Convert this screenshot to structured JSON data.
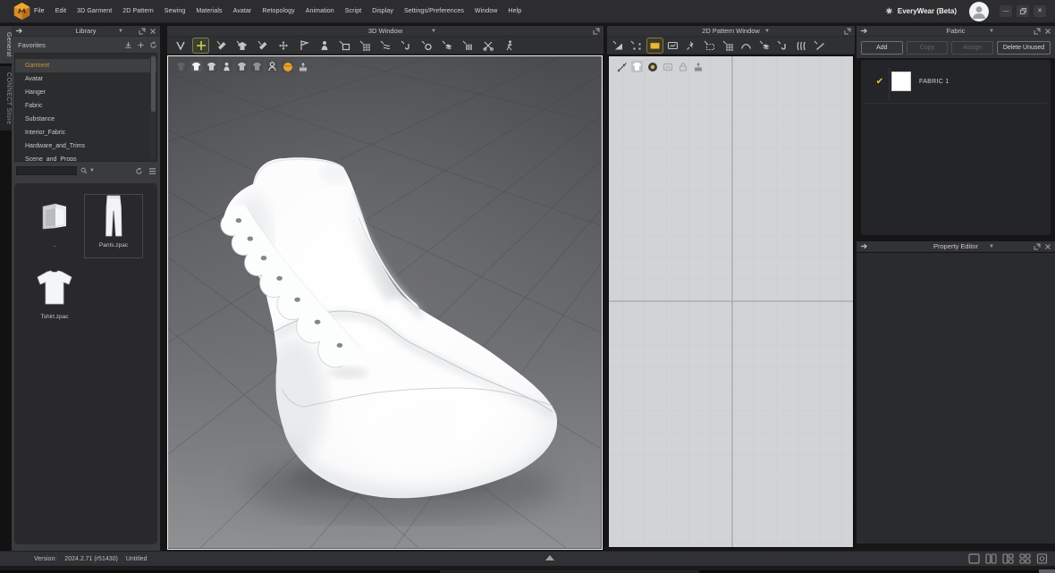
{
  "app": {
    "brand": "EveryWear (Beta)",
    "accent_color": "#cf9433",
    "selected_tool_color": "#e8b83a",
    "window_controls": [
      "minimize",
      "restore",
      "close"
    ]
  },
  "menu_bar": {
    "items": [
      "File",
      "Edit",
      "3D Garment",
      "2D Pattern",
      "Sewing",
      "Materials",
      "Avatar",
      "Retopology",
      "Animation",
      "Script",
      "Display",
      "Settings/Preferences",
      "Window",
      "Help"
    ]
  },
  "sidebar_tabs": {
    "general": "General",
    "connect_store": "CONNECT Store",
    "active": "General"
  },
  "library_panel": {
    "title": "Library",
    "favorites_label": "Favorites",
    "favorites_icons": [
      "download-icon",
      "add-icon",
      "refresh-icon"
    ],
    "favorites": [
      {
        "label": "Garment",
        "selected": true
      },
      {
        "label": "Avatar",
        "selected": false
      },
      {
        "label": "Hanger",
        "selected": false
      },
      {
        "label": "Fabric",
        "selected": false
      },
      {
        "label": "Substance",
        "selected": false
      },
      {
        "label": "Interior_Fabric",
        "selected": false
      },
      {
        "label": "Hardware_and_Trims",
        "selected": false
      },
      {
        "label": "Scene_and_Props",
        "selected": false
      }
    ],
    "search_value": "",
    "files": [
      {
        "label": "..",
        "type": "parent-folder"
      },
      {
        "label": "Pants.zpac",
        "type": "garment-pants"
      },
      {
        "label": "Tshirt.zpac",
        "type": "garment-tshirt"
      }
    ]
  },
  "viewport_3d": {
    "title": "3D Window",
    "toolbar_icons": [
      "v-stitch-tool",
      "plus-cursor-tool",
      "pen-tool",
      "garment-select-tool",
      "edit-pen-tool",
      "move-cross-tool",
      "flag-tool",
      "avatar-tool",
      "box-arrow-tool",
      "grid-arrow-tool",
      "wind-tool",
      "hook-tool",
      "ring-tool",
      "fabric-arrow-tool",
      "bars-arrow-tool",
      "scissors-tool",
      "walk-tool"
    ],
    "selected_tool_index": 1,
    "overlay_toggles": [
      "dark-shirt-toggle",
      "white-shirt-toggle",
      "texture-shirt-toggle",
      "person-toggle",
      "fabric-hand-toggle",
      "fabric-flat-toggle",
      "bust-toggle",
      "orange-sphere-toggle",
      "podium-toggle"
    ],
    "scene_object": "white high-top shoe model"
  },
  "viewport_2d": {
    "title": "2D Pattern Window",
    "toolbar_icons": [
      "transform-triangle-tool",
      "edit-points-tool",
      "yellow-rect-pattern-tool",
      "screen-rect-tool",
      "pin-tool",
      "dotted-box-tool",
      "grid-arrow-tool",
      "curve-tool",
      "fabric-arrow-tool",
      "hook-arrow-tool",
      "pleats-tool",
      "line-arrow-tool"
    ],
    "selected_tool_index": 2,
    "overlay_toggles": [
      "needle-toggle",
      "white-shirt-toggle",
      "dark-texture-toggle",
      "pale-box-toggle",
      "pale-lock-toggle",
      "podium-toggle"
    ]
  },
  "fabric_panel": {
    "title": "Fabric",
    "buttons": [
      {
        "label": "Add",
        "enabled": true
      },
      {
        "label": "Copy",
        "enabled": false
      },
      {
        "label": "Assign",
        "enabled": false
      },
      {
        "label": "Delete Unused",
        "enabled": true
      }
    ],
    "items": [
      {
        "name": "FABRIC 1",
        "checked": true,
        "swatch_color": "#ffffff"
      }
    ]
  },
  "property_editor": {
    "title": "Property Editor"
  },
  "status_bar": {
    "version_label": "Version:",
    "version_value": "2024.2.71 (r51430)",
    "document_name": "Untitled",
    "layout_icons": [
      "single-view-icon",
      "two-pane-icon",
      "one-plus-two-icon",
      "quad-view-icon",
      "reset-layout-icon"
    ]
  }
}
